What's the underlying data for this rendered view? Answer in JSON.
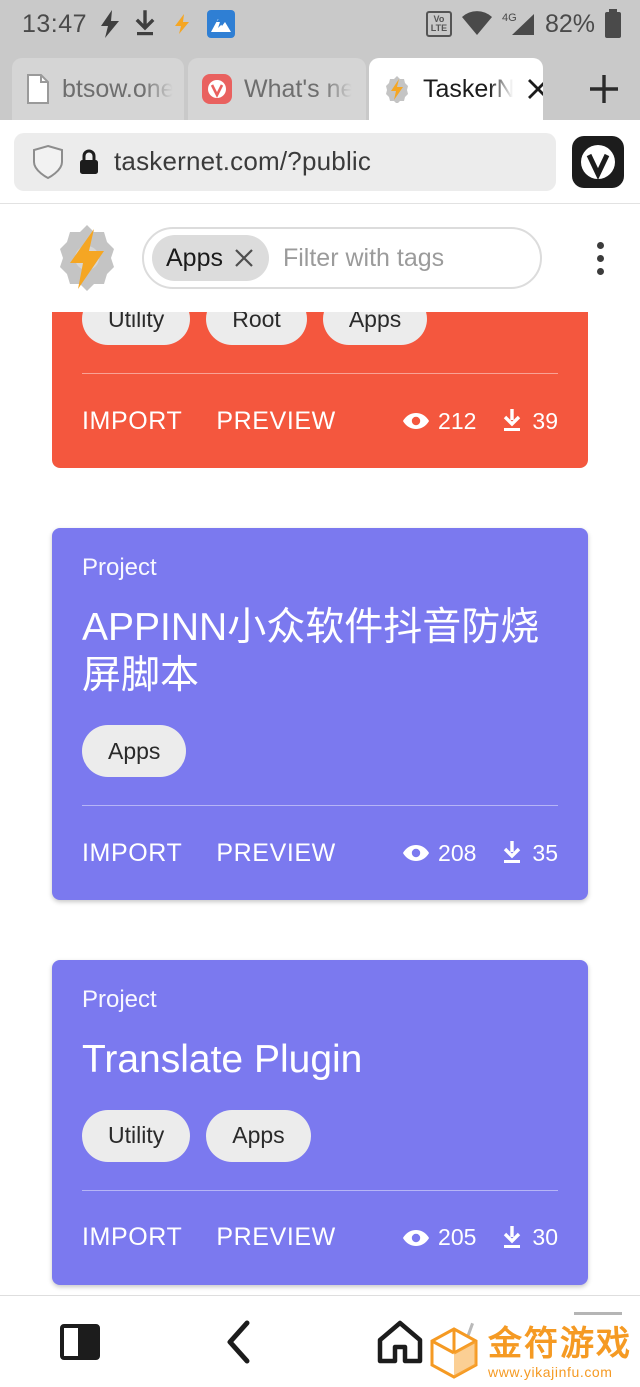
{
  "statusbar": {
    "time": "13:47",
    "icons": [
      "flash-icon",
      "download-icon",
      "tasker-icon",
      "vivaldi-sync-icon"
    ],
    "volte_top": "Vo",
    "volte_bottom": "LTE",
    "network": "4G",
    "battery_percent": "82%"
  },
  "tabs": [
    {
      "title": "btsow.one",
      "icon": "document-icon",
      "active": false
    },
    {
      "title": "What's ne",
      "icon": "vivaldi-icon",
      "active": false
    },
    {
      "title": "TaskerN",
      "icon": "tasker-gear-icon",
      "active": true
    }
  ],
  "newtab_label": "+",
  "urlbar": {
    "shield_icon": "shield-icon",
    "lock_icon": "lock-icon",
    "url": "taskernet.com/?public",
    "browser_button": "vivaldi-menu-button"
  },
  "appbar": {
    "logo": "tasker-logo",
    "active_tag": "Apps",
    "remove_tag_label": "×",
    "filter_placeholder": "Filter with tags",
    "menu": "overflow-menu"
  },
  "colors": {
    "card_orange": "#f4573e",
    "card_purple": "#7b79ef",
    "tag_bg": "#ececec",
    "accent_watermark": "#f59a23"
  },
  "cards": [
    {
      "kind": "",
      "title": "",
      "tags": [
        "Utility",
        "Root",
        "Apps"
      ],
      "import_label": "IMPORT",
      "preview_label": "PREVIEW",
      "views": "212",
      "downloads": "39",
      "color": "orange",
      "clipped": true
    },
    {
      "kind": "Project",
      "title": "APPINN小众软件抖音防烧屏脚本",
      "tags": [
        "Apps"
      ],
      "import_label": "IMPORT",
      "preview_label": "PREVIEW",
      "views": "208",
      "downloads": "35",
      "color": "purple",
      "clipped": false
    },
    {
      "kind": "Project",
      "title": "Translate Plugin",
      "tags": [
        "Utility",
        "Apps"
      ],
      "import_label": "IMPORT",
      "preview_label": "PREVIEW",
      "views": "205",
      "downloads": "30",
      "color": "purple",
      "clipped": false
    }
  ],
  "bottomnav": {
    "items": [
      "panel-toggle-icon",
      "back-icon",
      "home-icon"
    ]
  },
  "watermark": {
    "brand": "金符游戏",
    "url": "www.yikajinfu.com",
    "icon": "cube-icon"
  }
}
